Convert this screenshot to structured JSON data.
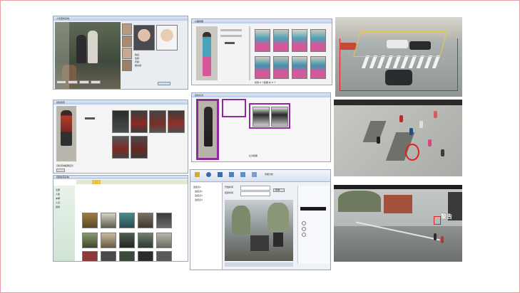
{
  "collage": {
    "panel_1": {
      "title": "人员查找系统",
      "buttons": [
        "搜索",
        "比对",
        "导出",
        "清除"
      ],
      "result_text": [
        "姓名:",
        "性别:",
        "年龄:",
        "相似度:"
      ]
    },
    "panel_2": {
      "title": "以图搜图",
      "status": "找到 8 个结果,共 8 个"
    },
    "panel_3": {
      "scene": "traffic-intersection"
    },
    "panel_4": {
      "title": "目标检索",
      "status": "目标查询结果显示"
    },
    "panel_5": {
      "title": "目标比对",
      "status": "比对结果"
    },
    "panel_6": {
      "scene": "crowd-plaza"
    },
    "panel_7": {
      "title": "视频检索系统",
      "sidebar_items": [
        "全部",
        "人脸",
        "车辆",
        "人员",
        "其他"
      ]
    },
    "panel_8": {
      "title": "智能分析",
      "toolbar": [
        "打开",
        "播放",
        "暂停",
        "停止",
        "导出",
        "设置",
        "帮助"
      ],
      "tree": [
        "监控点1",
        "监控点2",
        "监控点3",
        "监控点4"
      ],
      "start_label": "开始时间",
      "end_label": "结束时间",
      "query_button": "查询"
    },
    "panel_9": {
      "overlay_label": "警告",
      "scene": "roadside"
    }
  },
  "colors": {
    "frame_border": "#e8a0a6",
    "highlight_purple": "#8e2a9e",
    "alert_red": "#e02020",
    "window_blue": "#b9cde6"
  }
}
